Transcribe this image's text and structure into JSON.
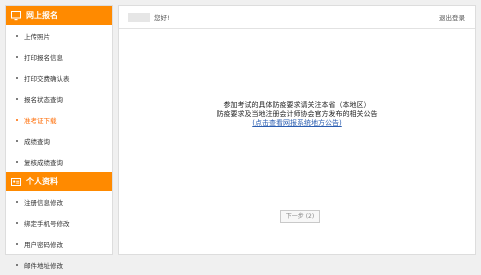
{
  "sidebar": {
    "sections": [
      {
        "title": "网上报名",
        "items": [
          {
            "label": "上传照片"
          },
          {
            "label": "打印报名信息"
          },
          {
            "label": "打印交费确认表"
          },
          {
            "label": "报名状态查询"
          },
          {
            "label": "准考证下载",
            "active": true
          },
          {
            "label": "成绩查询"
          },
          {
            "label": "复核成绩查询"
          }
        ]
      },
      {
        "title": "个人资料",
        "items": [
          {
            "label": "注册信息修改"
          },
          {
            "label": "绑定手机号修改"
          },
          {
            "label": "用户密码修改"
          },
          {
            "label": "邮件地址修改"
          }
        ]
      }
    ]
  },
  "header": {
    "greeting": "您好!",
    "logout": "退出登录"
  },
  "notice": {
    "line1": "参加考试的具体防疫要求请关注本省（本地区）",
    "line2": "防疫要求及当地注册会计师协会官方发布的相关公告",
    "link": "(点击查看网报系统地方公告)"
  },
  "next_button": "下一步 (2)",
  "colors": {
    "accent": "#ff8a00",
    "active_text": "#ff6a00",
    "link": "#2a5db0"
  },
  "icons": {
    "section1": "monitor-icon",
    "section2": "id-card-icon"
  }
}
